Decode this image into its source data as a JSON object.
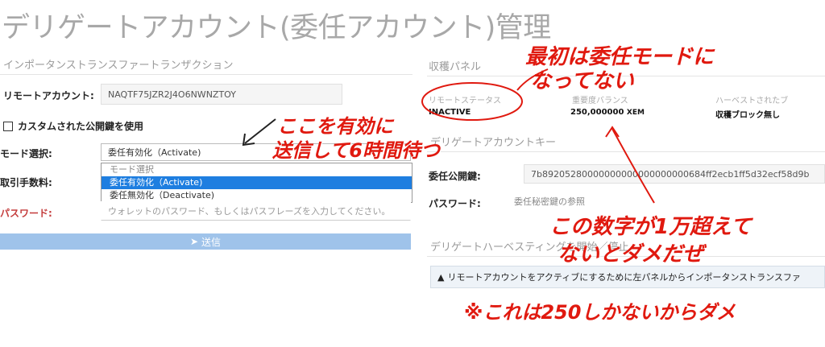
{
  "page_title": "デリゲートアカウント(委任アカウント)管理",
  "left": {
    "section_title": "インポータンストランスファートランザクション",
    "remote_account_label": "リモートアカウント:",
    "remote_account_value": "NAQTF75JZR2J4O6NWNZTOY",
    "custom_key_label": "カスタムされた公開鍵を使用",
    "mode_label": "モード選択:",
    "mode_selected": "委任有効化（Activate)",
    "mode_options": [
      "モード選択",
      "委任有効化（Activate)",
      "委任無効化（Deactivate)"
    ],
    "fee_label": "取引手数料:",
    "password_label": "パスワード:",
    "password_placeholder": "ウォレットのパスワード、もしくはパスフレーズを入力してください。",
    "send_label": "送信"
  },
  "right": {
    "panel_title": "収穫パネル",
    "col_remote_status": "リモートステータス",
    "col_balance": "重要度バランス",
    "col_harvest": "ハーベストされたブ",
    "status_value": "INACTIVE",
    "balance_value": "250,000000",
    "balance_unit": "XEM",
    "harvest_value": "収穫ブロック無し",
    "delegate_key_title": "デリゲートアカウントキー",
    "delegate_pubkey_label": "委任公開鍵:",
    "delegate_pubkey_value": "7b89205280000000000000000000684ff2ecb1ff5d32ecf58d9b",
    "password_label": "パスワード:",
    "password_placeholder": "委任秘密鍵の参照",
    "harvesting_title": "デリゲートハーベスティングを開始／停止",
    "alert_text": "リモートアカウントをアクティブにするために左パネルからインポータンストランスファ"
  },
  "annotations": {
    "note1_line1": "最初は委任モードに",
    "note1_line2": "なってない",
    "note2_line1": "ここを有効に",
    "note2_line2": "送信して6時間待つ",
    "note3_line1": "この数字が1万超えて",
    "note3_line2": "ないとダメだぜ",
    "note4": "※これは250しかないからダメ"
  },
  "colors": {
    "annotation": "#e0190f",
    "highlight": "#1e7ee0",
    "button": "#9fc3ea"
  }
}
